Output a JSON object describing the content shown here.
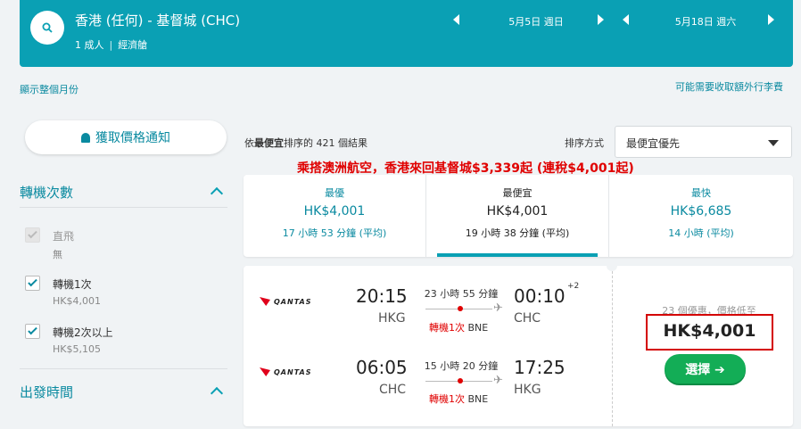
{
  "header": {
    "route": "香港 (任何) - 基督城 (CHC)",
    "passengers": "1 成人",
    "cabin": "經濟艙",
    "depart_date": "5月5日 週日",
    "return_date": "5月18日 週六"
  },
  "links": {
    "show_month": "顯示整個月份",
    "extra_fees": "可能需要收取額外行李費"
  },
  "sidebar": {
    "alert_button": "獲取價格通知",
    "stops_title": "轉機次數",
    "stops": [
      {
        "label": "直飛",
        "sub": "無",
        "checked": true,
        "disabled": true
      },
      {
        "label": "轉機1次",
        "sub": "HK$4,001",
        "checked": true,
        "disabled": false
      },
      {
        "label": "轉機2次以上",
        "sub": "HK$5,105",
        "checked": true,
        "disabled": false
      }
    ],
    "departure_title": "出發時間"
  },
  "results": {
    "count_prefix": "依",
    "count_bold": "最便宜",
    "count_suffix": "排序的 421 個結果",
    "sort_label": "排序方式",
    "sort_value": "最便宜優先"
  },
  "promo": "乘搭澳洲航空，香港來回基督城$3,339起 (連稅$4,001起)",
  "tabs": [
    {
      "title": "最優",
      "price": "HK$4,001",
      "sub": "17 小時 53 分鐘 (平均)",
      "active": false
    },
    {
      "title": "最便宜",
      "price": "HK$4,001",
      "sub": "19 小時 38 分鐘 (平均)",
      "active": true
    },
    {
      "title": "最快",
      "price": "HK$6,685",
      "sub": "14 小時 (平均)",
      "active": false
    }
  ],
  "flight": {
    "airline": "QANTAS",
    "outbound": {
      "dep_time": "20:15",
      "dep_iata": "HKG",
      "duration": "23 小時 55 分鐘",
      "stops": "轉機1次",
      "via": "BNE",
      "arr_time": "00:10",
      "arr_plus": "+2",
      "arr_iata": "CHC"
    },
    "inbound": {
      "dep_time": "06:05",
      "dep_iata": "CHC",
      "duration": "15 小時 20 分鐘",
      "stops": "轉機1次",
      "via": "BNE",
      "arr_time": "17:25",
      "arr_iata": "HKG"
    },
    "deals": "23 個優惠，價格低至",
    "price": "HK$4,001",
    "select_label": "選擇 ➔"
  },
  "colors": {
    "brand_teal": "#0aa0b4",
    "link_teal": "#0a8aa0",
    "select_green": "#13ad56",
    "highlight_red": "#d40000"
  }
}
